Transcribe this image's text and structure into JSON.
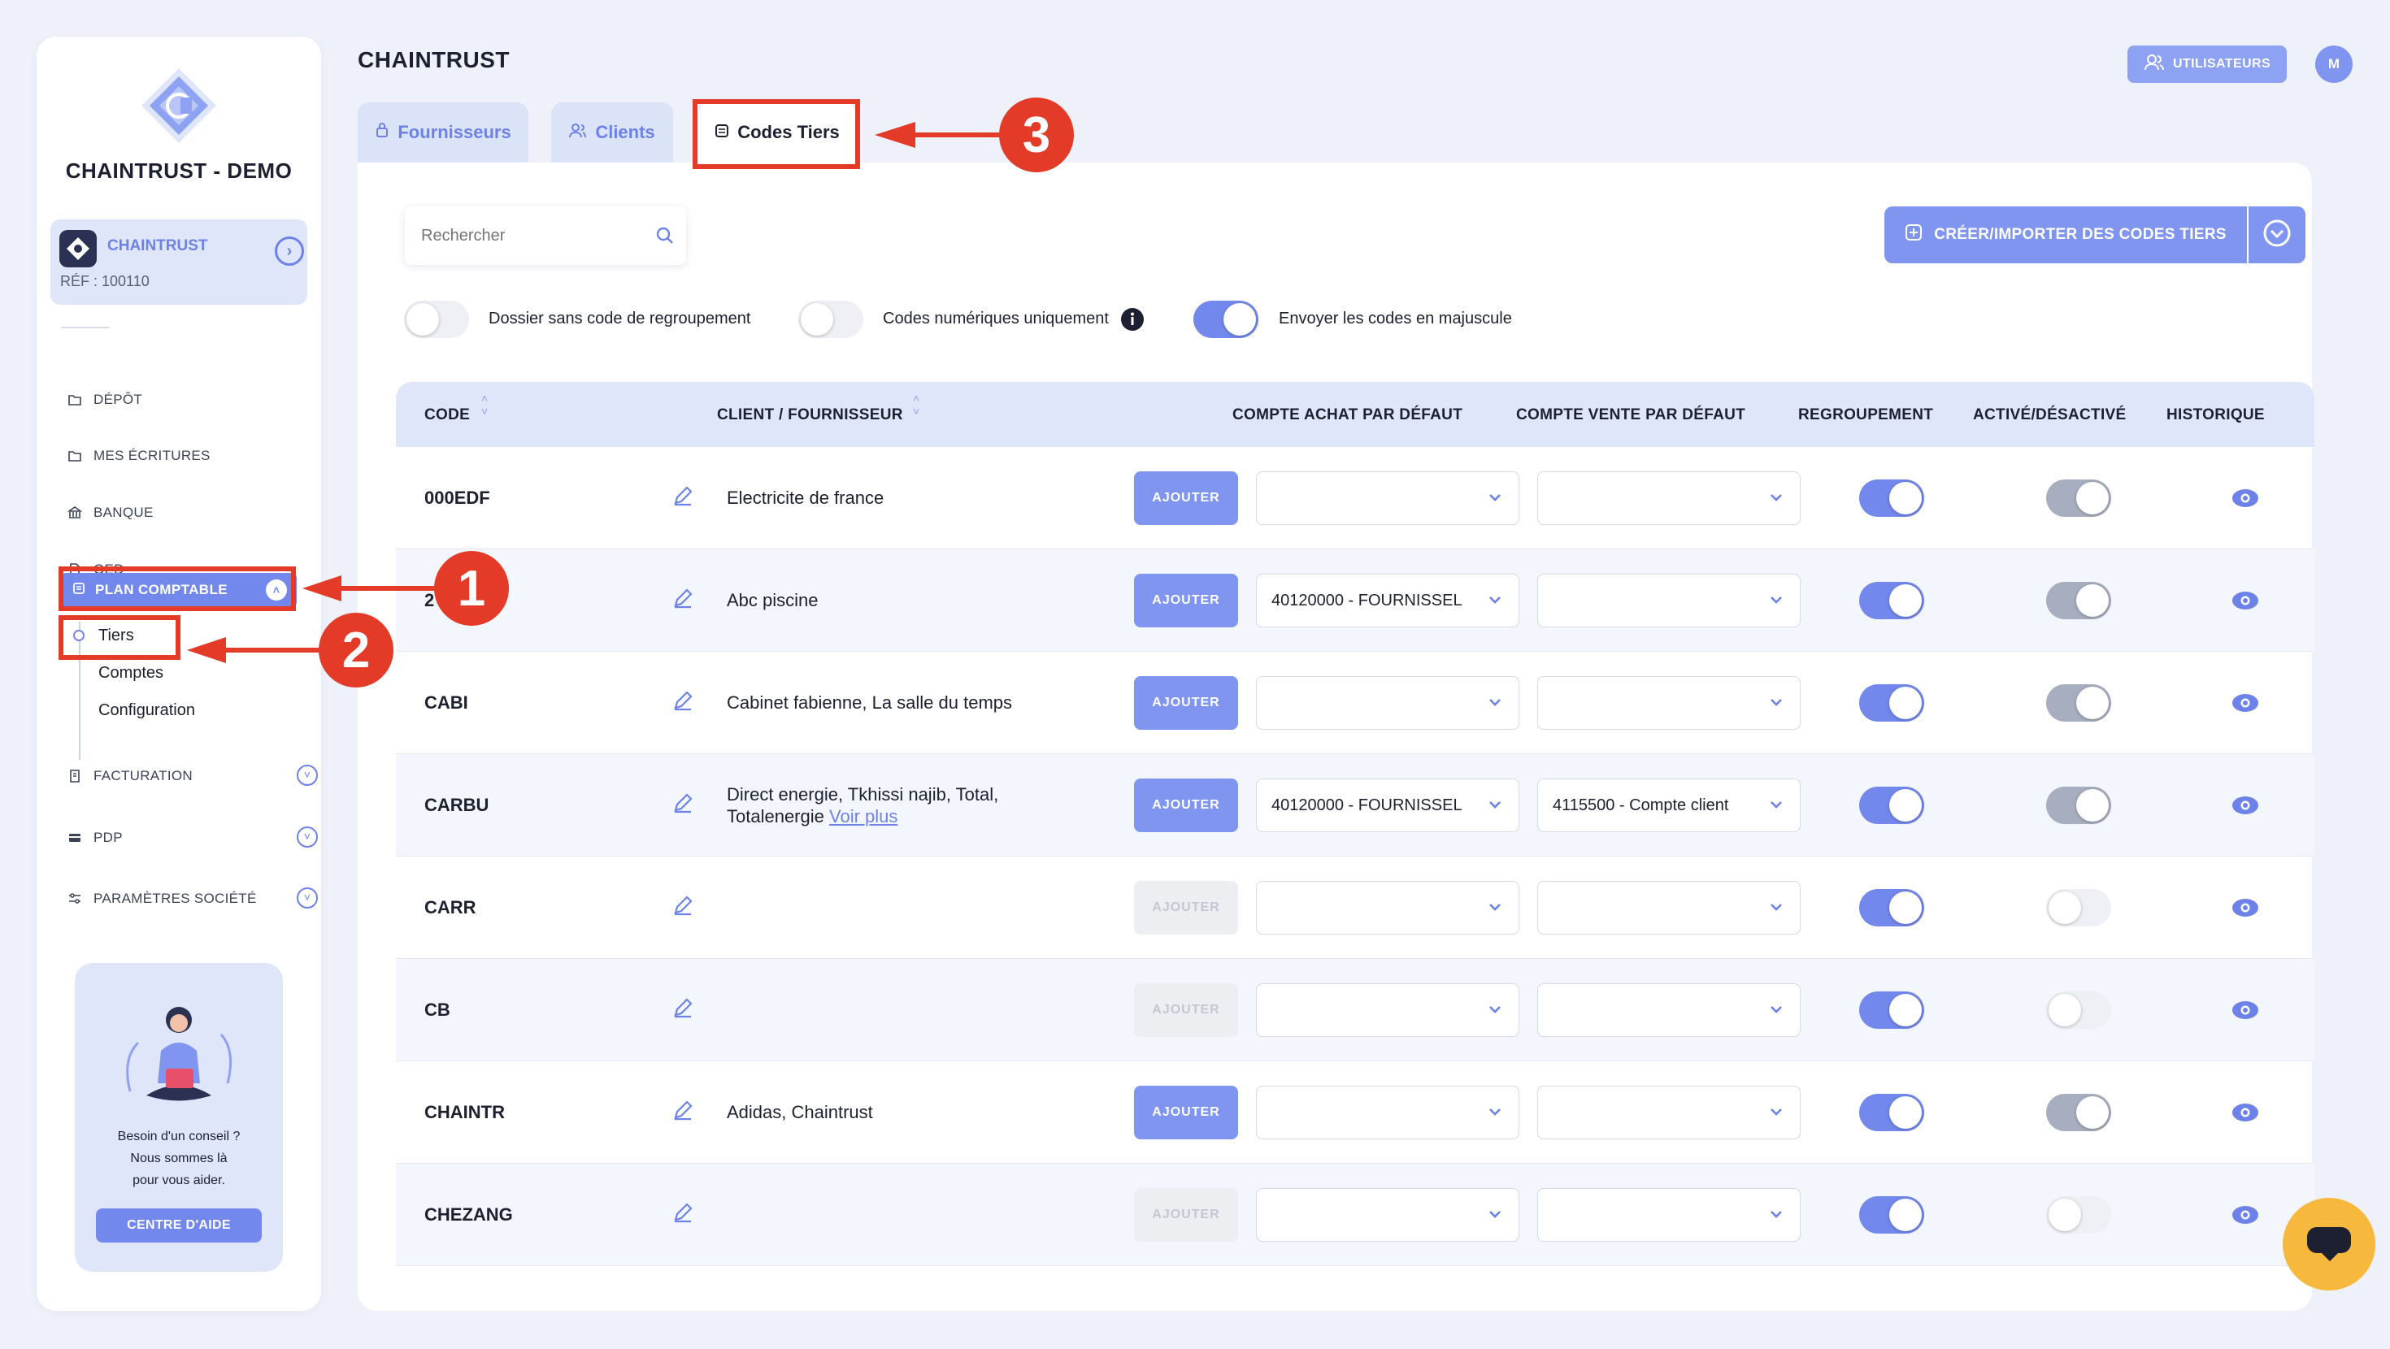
{
  "company": "CHAINTRUST - DEMO",
  "entity": {
    "name": "CHAINTRUST",
    "ref": "RÉF : 100110"
  },
  "nav": {
    "depot": "DÉPÔT",
    "ecritures": "MES ÉCRITURES",
    "banque": "BANQUE",
    "ged": "GED",
    "plan": "PLAN COMPTABLE",
    "sub": [
      "Tiers",
      "Comptes",
      "Configuration"
    ],
    "facturation": "FACTURATION",
    "pdp": "PDP",
    "parametres": "PARAMÈTRES SOCIÉTÉ"
  },
  "help": {
    "line1": "Besoin d'un conseil ?",
    "line2": "Nous sommes là",
    "line3": "pour vous aider.",
    "button": "CENTRE D'AIDE"
  },
  "header": {
    "title": "CHAINTRUST",
    "users_button": "UTILISATEURS",
    "avatar": "M"
  },
  "tabs": [
    "Fournisseurs",
    "Clients",
    "Codes Tiers"
  ],
  "annotations": [
    "1",
    "2",
    "3"
  ],
  "search": {
    "placeholder": "Rechercher"
  },
  "create_button": "CRÉER/IMPORTER DES CODES TIERS",
  "filters": [
    {
      "label": "Dossier sans code de regroupement",
      "on": false
    },
    {
      "label": "Codes numériques uniquement",
      "on": false
    },
    {
      "label": "Envoyer les codes en majuscule",
      "on": true
    }
  ],
  "columns": [
    "CODE",
    "CLIENT / FOURNISSEUR",
    "COMPTE ACHAT PAR DÉFAUT",
    "COMPTE VENTE PAR DÉFAUT",
    "REGROUPEMENT",
    "ACTIVÉ/DÉSACTIVÉ",
    "HISTORIQUE"
  ],
  "add_label": "AJOUTER",
  "see_more": "Voir plus",
  "rows": [
    {
      "code": "000EDF",
      "client": "Electricite de france",
      "achat": "",
      "vente": "",
      "regroupement": true,
      "active": true,
      "add_enabled": true
    },
    {
      "code": "2",
      "client": "Abc piscine",
      "achat": "40120000 - FOURNISSEL",
      "vente": "",
      "regroupement": true,
      "active": true,
      "add_enabled": true
    },
    {
      "code": "CABI",
      "client": "Cabinet fabienne, La salle du temps",
      "achat": "",
      "vente": "",
      "regroupement": true,
      "active": true,
      "add_enabled": true
    },
    {
      "code": "CARBU",
      "client": "Direct energie, Tkhissi najib, Total,",
      "client2": "Totalenergie",
      "achat": "40120000 - FOURNISSEL",
      "vente": "4115500 - Compte client",
      "regroupement": true,
      "active": true,
      "add_enabled": true
    },
    {
      "code": "CARR",
      "client": "",
      "achat": "",
      "vente": "",
      "regroupement": true,
      "active": false,
      "add_enabled": false
    },
    {
      "code": "CB",
      "client": "",
      "achat": "",
      "vente": "",
      "regroupement": true,
      "active": false,
      "add_enabled": false
    },
    {
      "code": "CHAINTR",
      "client": "Adidas, Chaintrust",
      "achat": "",
      "vente": "",
      "regroupement": true,
      "active": true,
      "add_enabled": true
    },
    {
      "code": "CHEZANG",
      "client": "",
      "achat": "",
      "vente": "",
      "regroupement": true,
      "active": false,
      "add_enabled": false
    }
  ],
  "colors": {
    "accent": "#7388ec",
    "annotation": "#e43a28",
    "chat": "#f6b93d"
  }
}
